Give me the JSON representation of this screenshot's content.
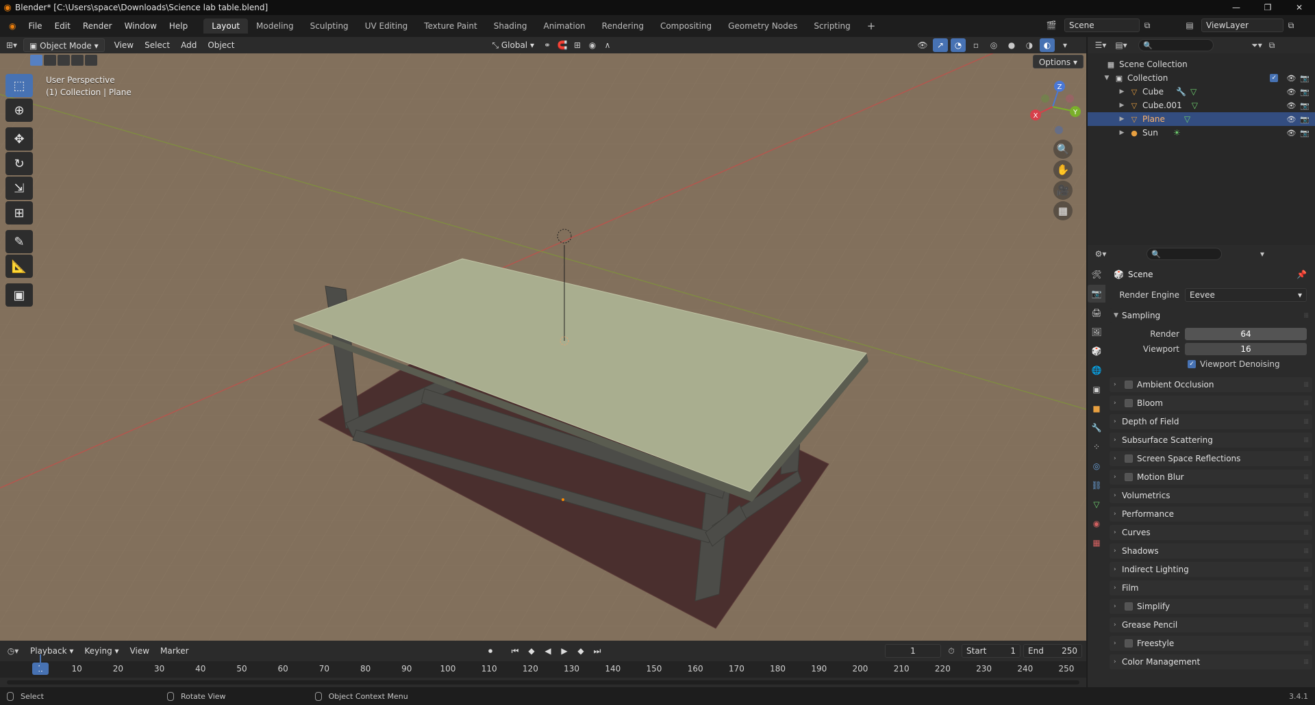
{
  "window": {
    "title": "Blender* [C:\\Users\\space\\Downloads\\Science lab table.blend]",
    "controls": [
      "—",
      "❐",
      "✕"
    ]
  },
  "menu": [
    "File",
    "Edit",
    "Render",
    "Window",
    "Help"
  ],
  "workspaces": {
    "active": "Layout",
    "tabs": [
      "Layout",
      "Modeling",
      "Sculpting",
      "UV Editing",
      "Texture Paint",
      "Shading",
      "Animation",
      "Rendering",
      "Compositing",
      "Geometry Nodes",
      "Scripting"
    ],
    "add": "+"
  },
  "scene_selector": {
    "value": "Scene"
  },
  "viewlayer_selector": {
    "value": "ViewLayer"
  },
  "viewport_header": {
    "mode": "Object Mode",
    "menus": [
      "View",
      "Select",
      "Add",
      "Object"
    ],
    "orientation": "Global",
    "options": "Options"
  },
  "viewport": {
    "perspective": "User Perspective",
    "collection_info": "(1) Collection | Plane",
    "floor_color": "#82705c",
    "table_top_color": "#a9ae8f",
    "table_leg_color": "#4c4c48",
    "plane_color": "#4a2f2e",
    "gizmo_axes": {
      "x": "X",
      "y": "Y",
      "z": "Z"
    }
  },
  "toolbar": {
    "tools": [
      {
        "name": "select-box",
        "glyph": "⬚"
      },
      {
        "name": "cursor",
        "glyph": "⊕"
      },
      {
        "name": "move",
        "glyph": "✥"
      },
      {
        "name": "rotate",
        "glyph": "↻"
      },
      {
        "name": "scale",
        "glyph": "⇲"
      },
      {
        "name": "transform",
        "glyph": "⊞"
      },
      {
        "name": "annotate",
        "glyph": "✎"
      },
      {
        "name": "measure",
        "glyph": "📐"
      },
      {
        "name": "add-cube",
        "glyph": "▣"
      }
    ]
  },
  "outliner": {
    "root": "Scene Collection",
    "collection": "Collection",
    "items": [
      {
        "name": "Cube",
        "type": "mesh",
        "selected": false
      },
      {
        "name": "Cube.001",
        "type": "mesh",
        "selected": false
      },
      {
        "name": "Plane",
        "type": "mesh",
        "selected": true
      },
      {
        "name": "Sun",
        "type": "light",
        "selected": false
      }
    ]
  },
  "properties": {
    "context": "Scene",
    "render_engine_label": "Render Engine",
    "render_engine": "Eevee",
    "sampling": {
      "title": "Sampling",
      "render_label": "Render",
      "render": "64",
      "viewport_label": "Viewport",
      "viewport": "16",
      "denoise_label": "Viewport Denoising"
    },
    "panels": [
      {
        "label": "Ambient Occlusion",
        "checkbox": true
      },
      {
        "label": "Bloom",
        "checkbox": true
      },
      {
        "label": "Depth of Field",
        "checkbox": false
      },
      {
        "label": "Subsurface Scattering",
        "checkbox": false
      },
      {
        "label": "Screen Space Reflections",
        "checkbox": true
      },
      {
        "label": "Motion Blur",
        "checkbox": true
      },
      {
        "label": "Volumetrics",
        "checkbox": false
      },
      {
        "label": "Performance",
        "checkbox": false
      },
      {
        "label": "Curves",
        "checkbox": false
      },
      {
        "label": "Shadows",
        "checkbox": false
      },
      {
        "label": "Indirect Lighting",
        "checkbox": false
      },
      {
        "label": "Film",
        "checkbox": false
      },
      {
        "label": "Simplify",
        "checkbox": true
      },
      {
        "label": "Grease Pencil",
        "checkbox": false
      },
      {
        "label": "Freestyle",
        "checkbox": true
      },
      {
        "label": "Color Management",
        "checkbox": false
      }
    ]
  },
  "timeline": {
    "menus": [
      "Playback",
      "Keying",
      "View",
      "Marker"
    ],
    "current_frame": "1",
    "start_label": "Start",
    "start": "1",
    "end_label": "End",
    "end": "250",
    "ticks": [
      "10",
      "20",
      "30",
      "40",
      "50",
      "60",
      "70",
      "80",
      "90",
      "100",
      "110",
      "120",
      "130",
      "140",
      "150",
      "160",
      "170",
      "180",
      "190",
      "200",
      "210",
      "220",
      "230",
      "240",
      "250"
    ]
  },
  "statusbar": {
    "select": "Select",
    "rotate": "Rotate View",
    "context_menu": "Object Context Menu",
    "version": "3.4.1"
  }
}
